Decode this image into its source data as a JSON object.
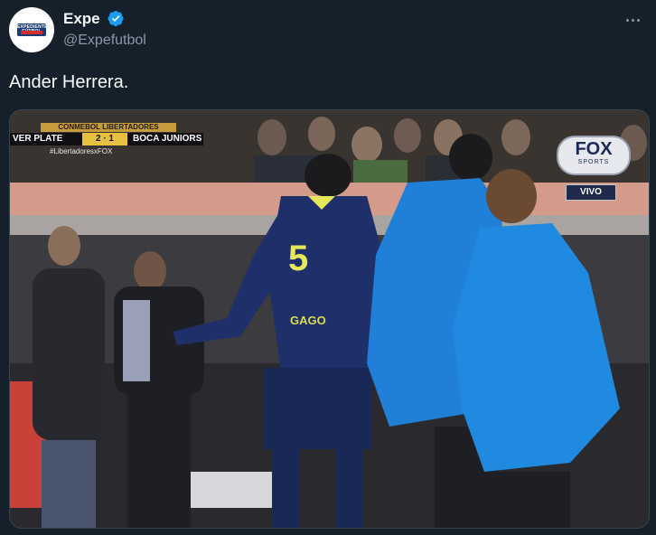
{
  "author": {
    "display_name": "Expe",
    "handle": "@Expefutbol",
    "avatar_logo_text": "EXPEDIENTE FÚTBOL"
  },
  "icons": {
    "verified": "verified-badge-icon",
    "more": "more-options-icon"
  },
  "colors": {
    "background": "#15202b",
    "verified": "#1d9bf0",
    "secondary_text": "#8b98a5"
  },
  "tweet": {
    "text": "Ander Herrera."
  },
  "media": {
    "scoreboard": {
      "competition": "CONMEBOL LIBERTADORES",
      "home": "VER PLATE",
      "score": "2 · 1",
      "away": "BOCA JUNIORS",
      "hashtag": "#LibertadoresxFOX"
    },
    "broadcaster": "FOX",
    "broadcaster_sub": "SPORTS",
    "live_label": "VIVO",
    "jersey_number": "5",
    "jersey_name": "GAGO"
  }
}
